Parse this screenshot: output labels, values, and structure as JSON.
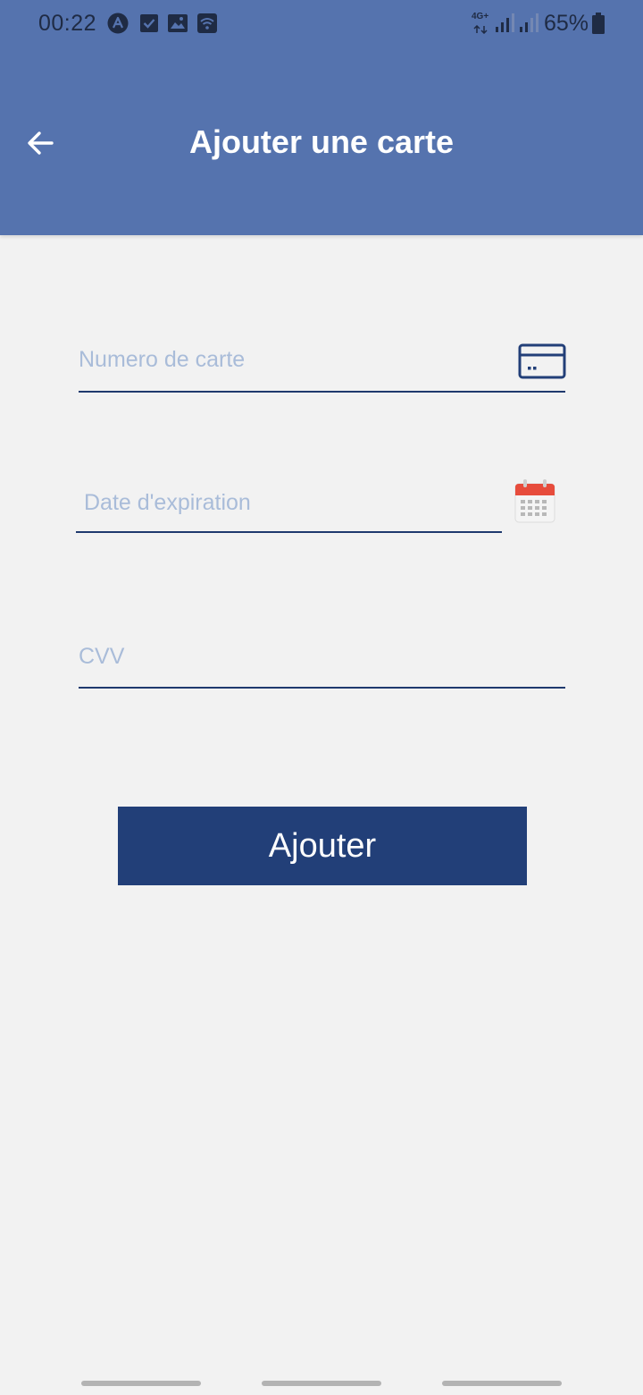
{
  "status_bar": {
    "time": "00:22",
    "battery": "65%",
    "network": "4G+",
    "icons": [
      "app-a-icon",
      "checkbox-icon",
      "gallery-icon",
      "wifi-icon",
      "signal-icon",
      "signal-icon",
      "battery-icon"
    ]
  },
  "header": {
    "title": "Ajouter une carte",
    "back_icon": "arrow-left-icon",
    "color": "#5573ae"
  },
  "form": {
    "card_number": {
      "placeholder": "Numero de carte",
      "value": "",
      "icon": "credit-card-icon"
    },
    "expiry_date": {
      "placeholder": "Date d'expiration",
      "value": "",
      "icon": "calendar-icon"
    },
    "cvv": {
      "placeholder": "CVV",
      "value": ""
    },
    "submit_label": "Ajouter"
  },
  "colors": {
    "accent": "#223f78",
    "background": "#f2f2f2",
    "placeholder": "#a9bcd9",
    "calendar_red": "#e74c3c"
  }
}
